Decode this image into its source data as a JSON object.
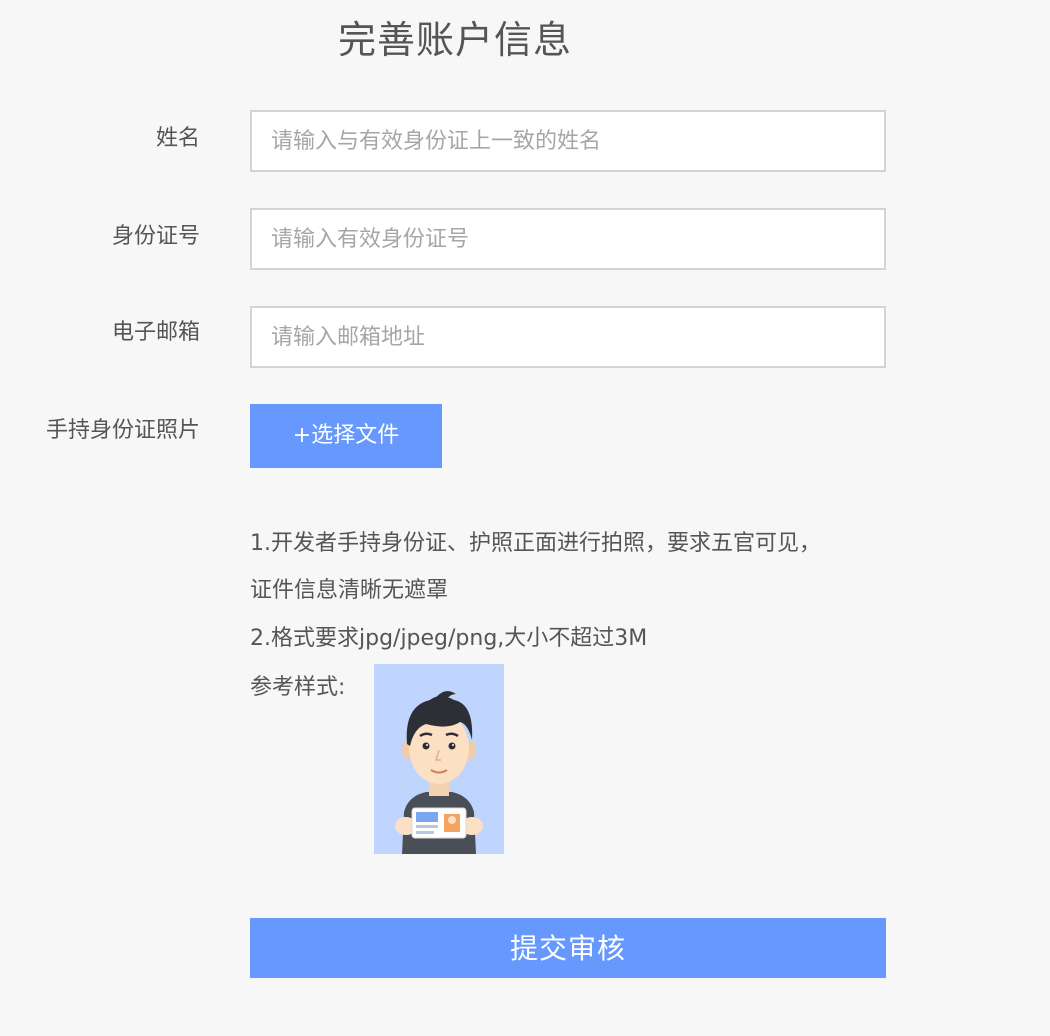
{
  "page": {
    "title": "完善账户信息"
  },
  "form": {
    "name": {
      "label": "姓名",
      "placeholder": "请输入与有效身份证上一致的姓名",
      "value": ""
    },
    "id_number": {
      "label": "身份证号",
      "placeholder": "请输入有效身份证号",
      "value": ""
    },
    "email": {
      "label": "电子邮箱",
      "placeholder": "请输入邮箱地址",
      "value": ""
    },
    "id_photo": {
      "label": "手持身份证照片",
      "button_label": "+选择文件"
    }
  },
  "instructions": {
    "line1": "1.开发者手持身份证、护照正面进行拍照，要求五官可见，",
    "line2": "证件信息清晰无遮罩",
    "line3": "2.格式要求jpg/jpeg/png,大小不超过3M",
    "sample_label": "参考样式:"
  },
  "submit": {
    "label": "提交审核"
  },
  "colors": {
    "accent": "#6698fd",
    "background": "#f7f7f7",
    "sample_background": "#c0d5fd",
    "text": "#555555",
    "placeholder": "#a6a6a6",
    "field_border": "#d4d4d4"
  },
  "icons": {
    "sample_photo": "person-holding-id-card-illustration"
  }
}
